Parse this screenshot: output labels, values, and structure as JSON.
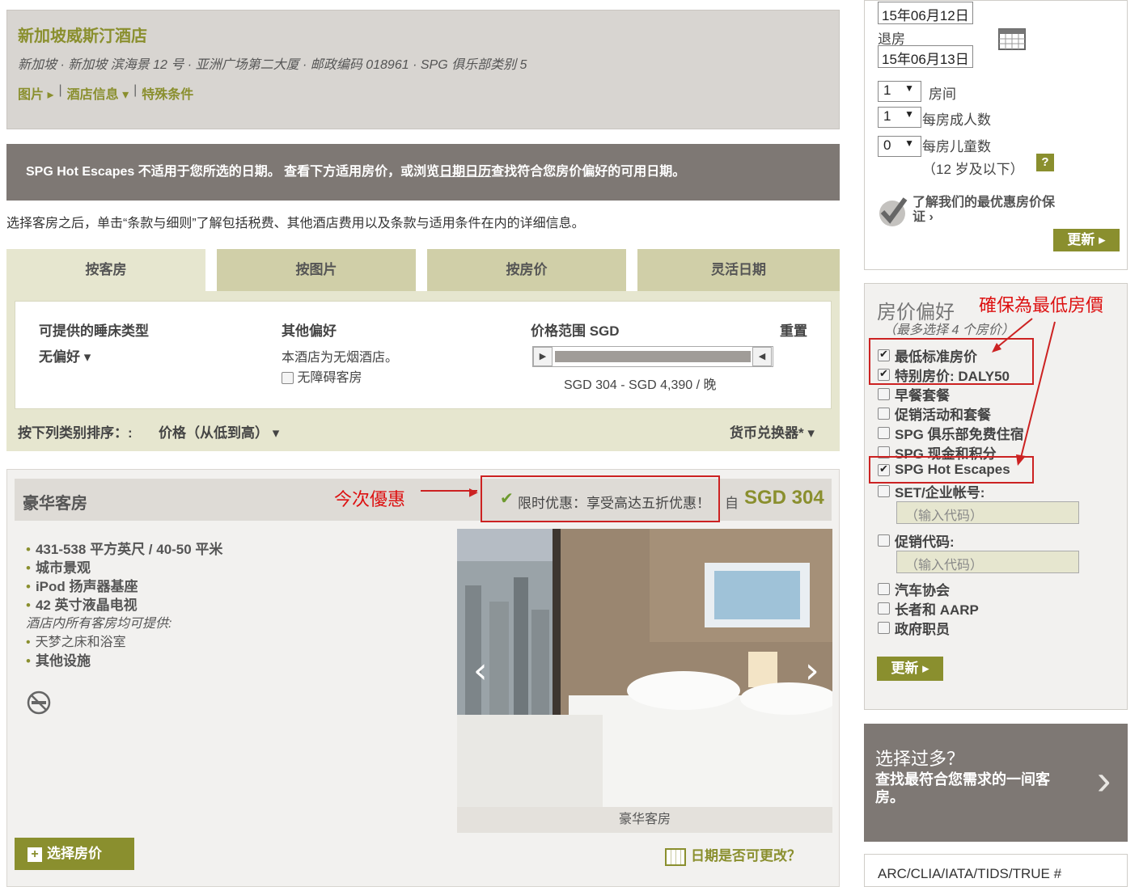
{
  "hotel": {
    "name": "新加坡威斯汀酒店",
    "address": "新加坡 · 新加坡 滨海景 12 号 · 亚洲广场第二大厦 · 邮政编码 018961 · SPG 俱乐部类别 5",
    "links": [
      "图片 ▸",
      "酒店信息 ▾",
      "特殊条件"
    ],
    "link_sep": "|"
  },
  "notice": {
    "part1": "SPG Hot Escapes 不适用于您所选的日期。 查看下方适用房价，或浏览",
    "link": "日期日历",
    "part2": "查找符合您房价偏好的可用日期。"
  },
  "instruction": "选择客房之后，单击“条款与细则”了解包括税费、其他酒店费用以及条款与适用条件在内的详细信息。",
  "tabs": [
    "按客房",
    "按图片",
    "按房价",
    "灵活日期"
  ],
  "filters": {
    "bed_label": "可提供的睡床类型",
    "bed_value": "无偏好 ▾",
    "other_label": "其他偏好",
    "nonsmoking": "本酒店为无烟酒店。",
    "accessible": "无障碍客房",
    "price_label": "价格范围 SGD",
    "reset": "重置",
    "price_range": "SGD 304 - SGD 4,390 / 晚",
    "sort_label": "按下列类别排序：:",
    "sort_value": "价格（从低到高） ▾",
    "currency": "货币兑换器* ▾"
  },
  "room": {
    "title": "豪华客房",
    "offer": "限时优惠：享受高达五折优惠！",
    "price_from": "自",
    "price": "SGD 304",
    "features": [
      "431-538 平方英尺 / 40-50 平米",
      "城市景观",
      "iPod 扬声器基座",
      "42 英寸液晶电视"
    ],
    "all_rooms_label": "酒店内所有客房均可提供:",
    "all_rooms_features": [
      "天梦之床和浴室"
    ],
    "more": "其他设施",
    "photo_caption": "豪华客房",
    "select_button": "选择房价",
    "date_change": "日期是否可更改？"
  },
  "annotations": {
    "offer_note": "今次優惠",
    "lowest_note": "確保為最低房價"
  },
  "search": {
    "checkin": "15年06月12日",
    "checkout_label": "退房",
    "checkout": "15年06月13日",
    "rooms_value": "1",
    "rooms_label": "房间",
    "adults_value": "1",
    "adults_label": "每房成人数",
    "children_value": "0",
    "children_label": "每房儿童数",
    "children_note": "（12 岁及以下）",
    "help": "?",
    "guarantee": "了解我们的最优惠房价保证 ›",
    "update": "更新 ▸"
  },
  "rate_pref": {
    "title": "房价偏好",
    "subtitle": "（最多选择 4 个房价）",
    "items": [
      {
        "label": "最低标准房价",
        "checked": true
      },
      {
        "label": "特别房价: DALY50",
        "checked": true
      },
      {
        "label": "早餐套餐",
        "checked": false
      },
      {
        "label": "促销活动和套餐",
        "checked": false
      },
      {
        "label": "SPG 俱乐部免费住宿",
        "checked": false
      },
      {
        "label": "SPG 现金和积分",
        "checked": false
      },
      {
        "label": "SPG Hot Escapes",
        "checked": true
      },
      {
        "label": "SET/企业帐号:",
        "checked": false
      }
    ],
    "code_placeholder": "（输入代码）",
    "promo_label": "促销代码:",
    "promo_placeholder": "（输入代码）",
    "others": [
      "汽车协会",
      "长者和 AARP",
      "政府职员"
    ],
    "update": "更新 ▸"
  },
  "promo": {
    "line1": "选择过多？",
    "line2": "查找最符合您需求的一间客房。",
    "arrow": "›"
  },
  "iata": "ARC/CLIA/IATA/TIDS/TRUE #",
  "colors": {
    "accent": "#8a8f2e",
    "header_bg": "#d8d5d1",
    "notice_bg": "#7e7874",
    "tab_bg": "#d0cfa8",
    "panel_bg": "#e6e6cf",
    "annotation_red": "#cc2222"
  }
}
